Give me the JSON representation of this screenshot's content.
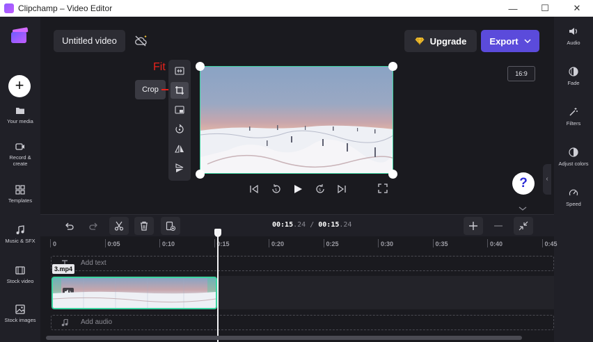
{
  "window": {
    "title": "Clipchamp – Video Editor",
    "minimize": "—",
    "maximize": "☐",
    "close": "✕"
  },
  "sidebar": {
    "add_label": "+",
    "items": [
      {
        "label": "Your media",
        "icon": "folder-icon"
      },
      {
        "label": "Record & create",
        "icon": "camera-icon"
      },
      {
        "label": "Templates",
        "icon": "templates-icon"
      },
      {
        "label": "Music & SFX",
        "icon": "music-icon"
      },
      {
        "label": "Stock video",
        "icon": "film-icon"
      },
      {
        "label": "Stock images",
        "icon": "image-icon"
      }
    ]
  },
  "header": {
    "project_title": "Untitled video",
    "upgrade_label": "Upgrade",
    "export_label": "Export"
  },
  "preview": {
    "aspect_ratio": "16:9",
    "fit_label": "Fit",
    "crop_tooltip": "Crop",
    "help_label": "?"
  },
  "rightbar": {
    "items": [
      {
        "label": "Audio",
        "icon": "speaker-icon"
      },
      {
        "label": "Fade",
        "icon": "fade-icon"
      },
      {
        "label": "Filters",
        "icon": "wand-icon"
      },
      {
        "label": "Adjust colors",
        "icon": "contrast-icon"
      },
      {
        "label": "Speed",
        "icon": "speedometer-icon"
      }
    ]
  },
  "timeline": {
    "current_time_main": "00:15",
    "current_time_frac": ".24",
    "separator": "/",
    "total_time_main": "00:15",
    "total_time_frac": ".24",
    "ruler_labels": [
      "0",
      "0:05",
      "0:10",
      "0:15",
      "0:20",
      "0:25",
      "0:30",
      "0:35",
      "0:40",
      "0:45"
    ],
    "add_text_label": "Add text",
    "add_audio_label": "Add audio",
    "clip_name": "3.mp4"
  },
  "colors": {
    "accent": "#5b4bdb",
    "clip_border": "#3bd4a0",
    "fit_red": "#e8221b"
  }
}
